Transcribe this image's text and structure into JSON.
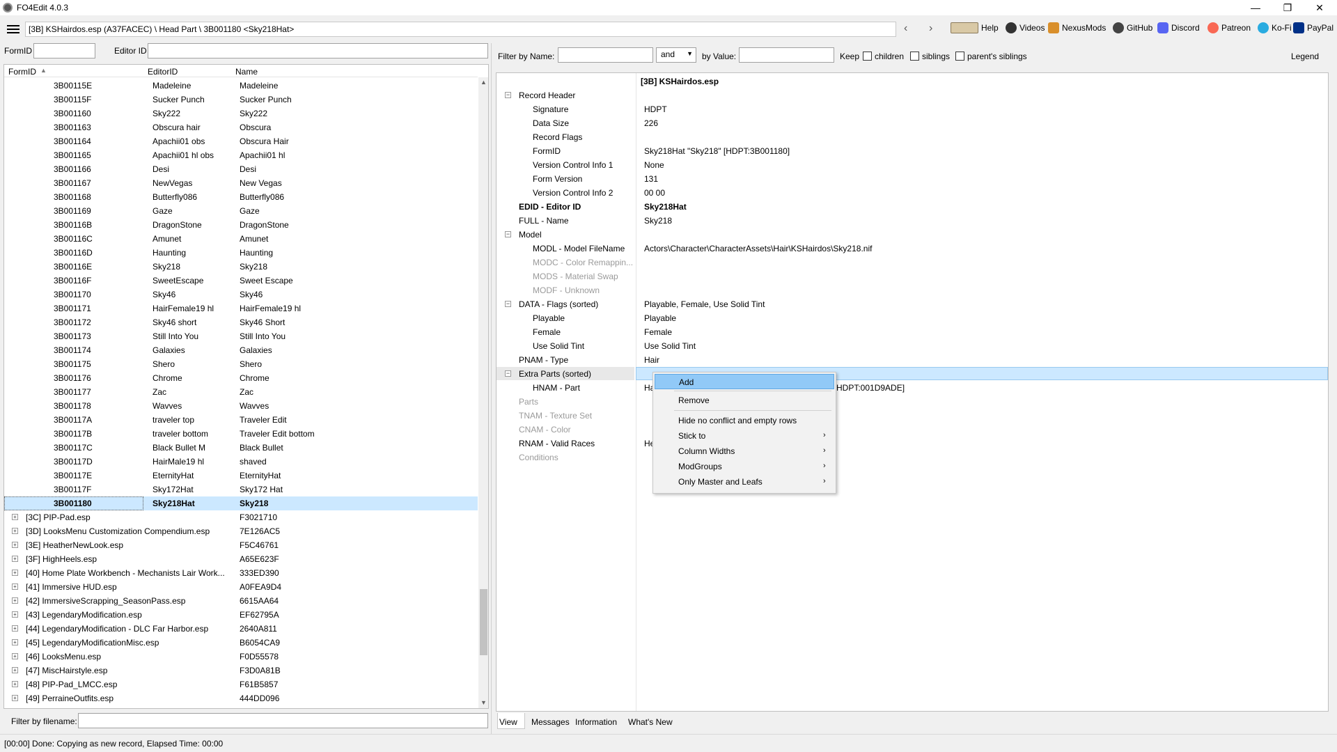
{
  "window": {
    "title": "FO4Edit 4.0.3",
    "minimize": "—",
    "maximize": "❐",
    "close": "✕"
  },
  "pathbar": {
    "path": "[3B] KSHairdos.esp (A37FACEC) \\ Head Part \\ 3B001180 <Sky218Hat>",
    "back": "‹",
    "forward": "›",
    "links": [
      {
        "label": "Help",
        "icon": "book-icon"
      },
      {
        "label": "Videos",
        "icon": "video-icon"
      },
      {
        "label": "NexusMods",
        "icon": "nexus-icon"
      },
      {
        "label": "GitHub",
        "icon": "github-icon"
      },
      {
        "label": "Discord",
        "icon": "discord-icon"
      },
      {
        "label": "Patreon",
        "icon": "patreon-icon"
      },
      {
        "label": "Ko-Fi",
        "icon": "kofi-icon"
      },
      {
        "label": "PayPal",
        "icon": "paypal-icon"
      }
    ]
  },
  "left_filter": {
    "formid_label": "FormID",
    "formid_value": "",
    "editorid_label": "Editor ID",
    "editorid_value": ""
  },
  "tree": {
    "columns": [
      "FormID",
      "EditorID",
      "Name"
    ],
    "rows": [
      {
        "formid": "3B00115E",
        "editorid": "Madeleine",
        "name": "Madeleine"
      },
      {
        "formid": "3B00115F",
        "editorid": "Sucker Punch",
        "name": "Sucker Punch"
      },
      {
        "formid": "3B001160",
        "editorid": "Sky222",
        "name": "Sky222"
      },
      {
        "formid": "3B001163",
        "editorid": "Obscura hair",
        "name": "Obscura"
      },
      {
        "formid": "3B001164",
        "editorid": "Apachii01 obs",
        "name": "Obscura Hair"
      },
      {
        "formid": "3B001165",
        "editorid": "Apachii01 hl obs",
        "name": "Apachii01 hl"
      },
      {
        "formid": "3B001166",
        "editorid": "Desi",
        "name": "Desi"
      },
      {
        "formid": "3B001167",
        "editorid": "NewVegas",
        "name": "New Vegas"
      },
      {
        "formid": "3B001168",
        "editorid": "Butterfly086",
        "name": "Butterfly086"
      },
      {
        "formid": "3B001169",
        "editorid": "Gaze",
        "name": "Gaze"
      },
      {
        "formid": "3B00116B",
        "editorid": "DragonStone",
        "name": "DragonStone"
      },
      {
        "formid": "3B00116C",
        "editorid": "Amunet",
        "name": "Amunet"
      },
      {
        "formid": "3B00116D",
        "editorid": "Haunting",
        "name": "Haunting"
      },
      {
        "formid": "3B00116E",
        "editorid": "Sky218",
        "name": "Sky218"
      },
      {
        "formid": "3B00116F",
        "editorid": "SweetEscape",
        "name": "Sweet Escape"
      },
      {
        "formid": "3B001170",
        "editorid": "Sky46",
        "name": "Sky46"
      },
      {
        "formid": "3B001171",
        "editorid": "HairFemale19 hl",
        "name": "HairFemale19 hl"
      },
      {
        "formid": "3B001172",
        "editorid": "Sky46 short",
        "name": "Sky46 Short"
      },
      {
        "formid": "3B001173",
        "editorid": "Still Into You",
        "name": "Still Into You"
      },
      {
        "formid": "3B001174",
        "editorid": "Galaxies",
        "name": "Galaxies"
      },
      {
        "formid": "3B001175",
        "editorid": "Shero",
        "name": "Shero"
      },
      {
        "formid": "3B001176",
        "editorid": "Chrome",
        "name": "Chrome"
      },
      {
        "formid": "3B001177",
        "editorid": "Zac",
        "name": "Zac"
      },
      {
        "formid": "3B001178",
        "editorid": "Wavves",
        "name": "Wavves"
      },
      {
        "formid": "3B00117A",
        "editorid": "traveler top",
        "name": "Traveler Edit"
      },
      {
        "formid": "3B00117B",
        "editorid": "traveler bottom",
        "name": "Traveler Edit bottom"
      },
      {
        "formid": "3B00117C",
        "editorid": "Black Bullet M",
        "name": "Black Bullet"
      },
      {
        "formid": "3B00117D",
        "editorid": "HairMale19 hl",
        "name": "shaved"
      },
      {
        "formid": "3B00117E",
        "editorid": "EternityHat",
        "name": "EternityHat"
      },
      {
        "formid": "3B00117F",
        "editorid": "Sky172Hat",
        "name": "Sky172 Hat"
      },
      {
        "formid": "3B001180",
        "editorid": "Sky218Hat",
        "name": "Sky218"
      }
    ],
    "plugins": [
      {
        "name": "[3C] PIP-Pad.esp",
        "crc": "F3021710"
      },
      {
        "name": "[3D] LooksMenu Customization Compendium.esp",
        "crc": "7E126AC5"
      },
      {
        "name": "[3E] HeatherNewLook.esp",
        "crc": "F5C46761"
      },
      {
        "name": "[3F] HighHeels.esp",
        "crc": "A65E623F"
      },
      {
        "name": "[40] Home Plate Workbench - Mechanists Lair Work...",
        "crc": "333ED390"
      },
      {
        "name": "[41] Immersive HUD.esp",
        "crc": "A0FEA9D4"
      },
      {
        "name": "[42] ImmersiveScrapping_SeasonPass.esp",
        "crc": "6615AA64"
      },
      {
        "name": "[43] LegendaryModification.esp",
        "crc": "EF62795A"
      },
      {
        "name": "[44] LegendaryModification - DLC Far Harbor.esp",
        "crc": "2640A811"
      },
      {
        "name": "[45] LegendaryModificationMisc.esp",
        "crc": "B6054CA9"
      },
      {
        "name": "[46] LooksMenu.esp",
        "crc": "F0D55578"
      },
      {
        "name": "[47] MiscHairstyle.esp",
        "crc": "F3D0A81B"
      },
      {
        "name": "[48] PIP-Pad_LMCC.esp",
        "crc": "F61B5857"
      },
      {
        "name": "[49] PerraineOutfits.esp",
        "crc": "444DD096"
      }
    ]
  },
  "filename_filter": {
    "label": "Filter by filename:",
    "value": ""
  },
  "right_filter": {
    "by_name_label": "Filter by Name:",
    "name_value": "",
    "op_value": "and",
    "by_value_label": "by Value:",
    "value_value": "",
    "keep_label": "Keep",
    "children_label": "children",
    "siblings_label": "siblings",
    "parents_siblings_label": "parent's siblings",
    "legend_label": "Legend"
  },
  "record_view": {
    "file_header": "[3B] KSHairdos.esp",
    "rows": [
      {
        "key": "Record Header",
        "value": ""
      },
      {
        "key": "Signature",
        "value": "HDPT"
      },
      {
        "key": "Data Size",
        "value": "226"
      },
      {
        "key": "Record Flags",
        "value": ""
      },
      {
        "key": "FormID",
        "value": "Sky218Hat \"Sky218\" [HDPT:3B001180]"
      },
      {
        "key": "Version Control Info 1",
        "value": "None"
      },
      {
        "key": "Form Version",
        "value": "131"
      },
      {
        "key": "Version Control Info 2",
        "value": "00 00"
      },
      {
        "key": "EDID - Editor ID",
        "value": "Sky218Hat"
      },
      {
        "key": "FULL - Name",
        "value": "Sky218"
      },
      {
        "key": "Model",
        "value": ""
      },
      {
        "key": "MODL - Model FileName",
        "value": "Actors\\Character\\CharacterAssets\\Hair\\KSHairdos\\Sky218.nif"
      },
      {
        "key": "MODC - Color Remappin...",
        "value": ""
      },
      {
        "key": "MODS - Material Swap",
        "value": ""
      },
      {
        "key": "MODF - Unknown",
        "value": ""
      },
      {
        "key": "DATA - Flags (sorted)",
        "value": "Playable, Female, Use Solid Tint"
      },
      {
        "key": "Playable",
        "value": "Playable"
      },
      {
        "key": "Female",
        "value": "Female"
      },
      {
        "key": "Use Solid Tint",
        "value": "Use Solid Tint"
      },
      {
        "key": "PNAM - Type",
        "value": "Hair"
      },
      {
        "key": "Extra Parts (sorted)",
        "value": ""
      },
      {
        "key": "HNAM - Part",
        "value": "Ha"
      },
      {
        "key": "Parts",
        "value": ""
      },
      {
        "key": "TNAM - Texture Set",
        "value": ""
      },
      {
        "key": "CNAM - Color",
        "value": ""
      },
      {
        "key": "RNAM - Valid Races",
        "value": "He"
      },
      {
        "key": "Conditions",
        "value": ""
      }
    ],
    "hnam_tail": "HDPT:001D9ADE]"
  },
  "context_menu": {
    "items": [
      "Add",
      "Remove",
      "Hide no conflict and empty rows",
      "Stick to",
      "Column Widths",
      "ModGroups",
      "Only Master and Leafs"
    ]
  },
  "bottom_tabs": [
    "View",
    "Messages",
    "Information",
    "What's New"
  ],
  "status": {
    "text": "[00:00] Done: Copying as new record, Elapsed Time: 00:00"
  }
}
